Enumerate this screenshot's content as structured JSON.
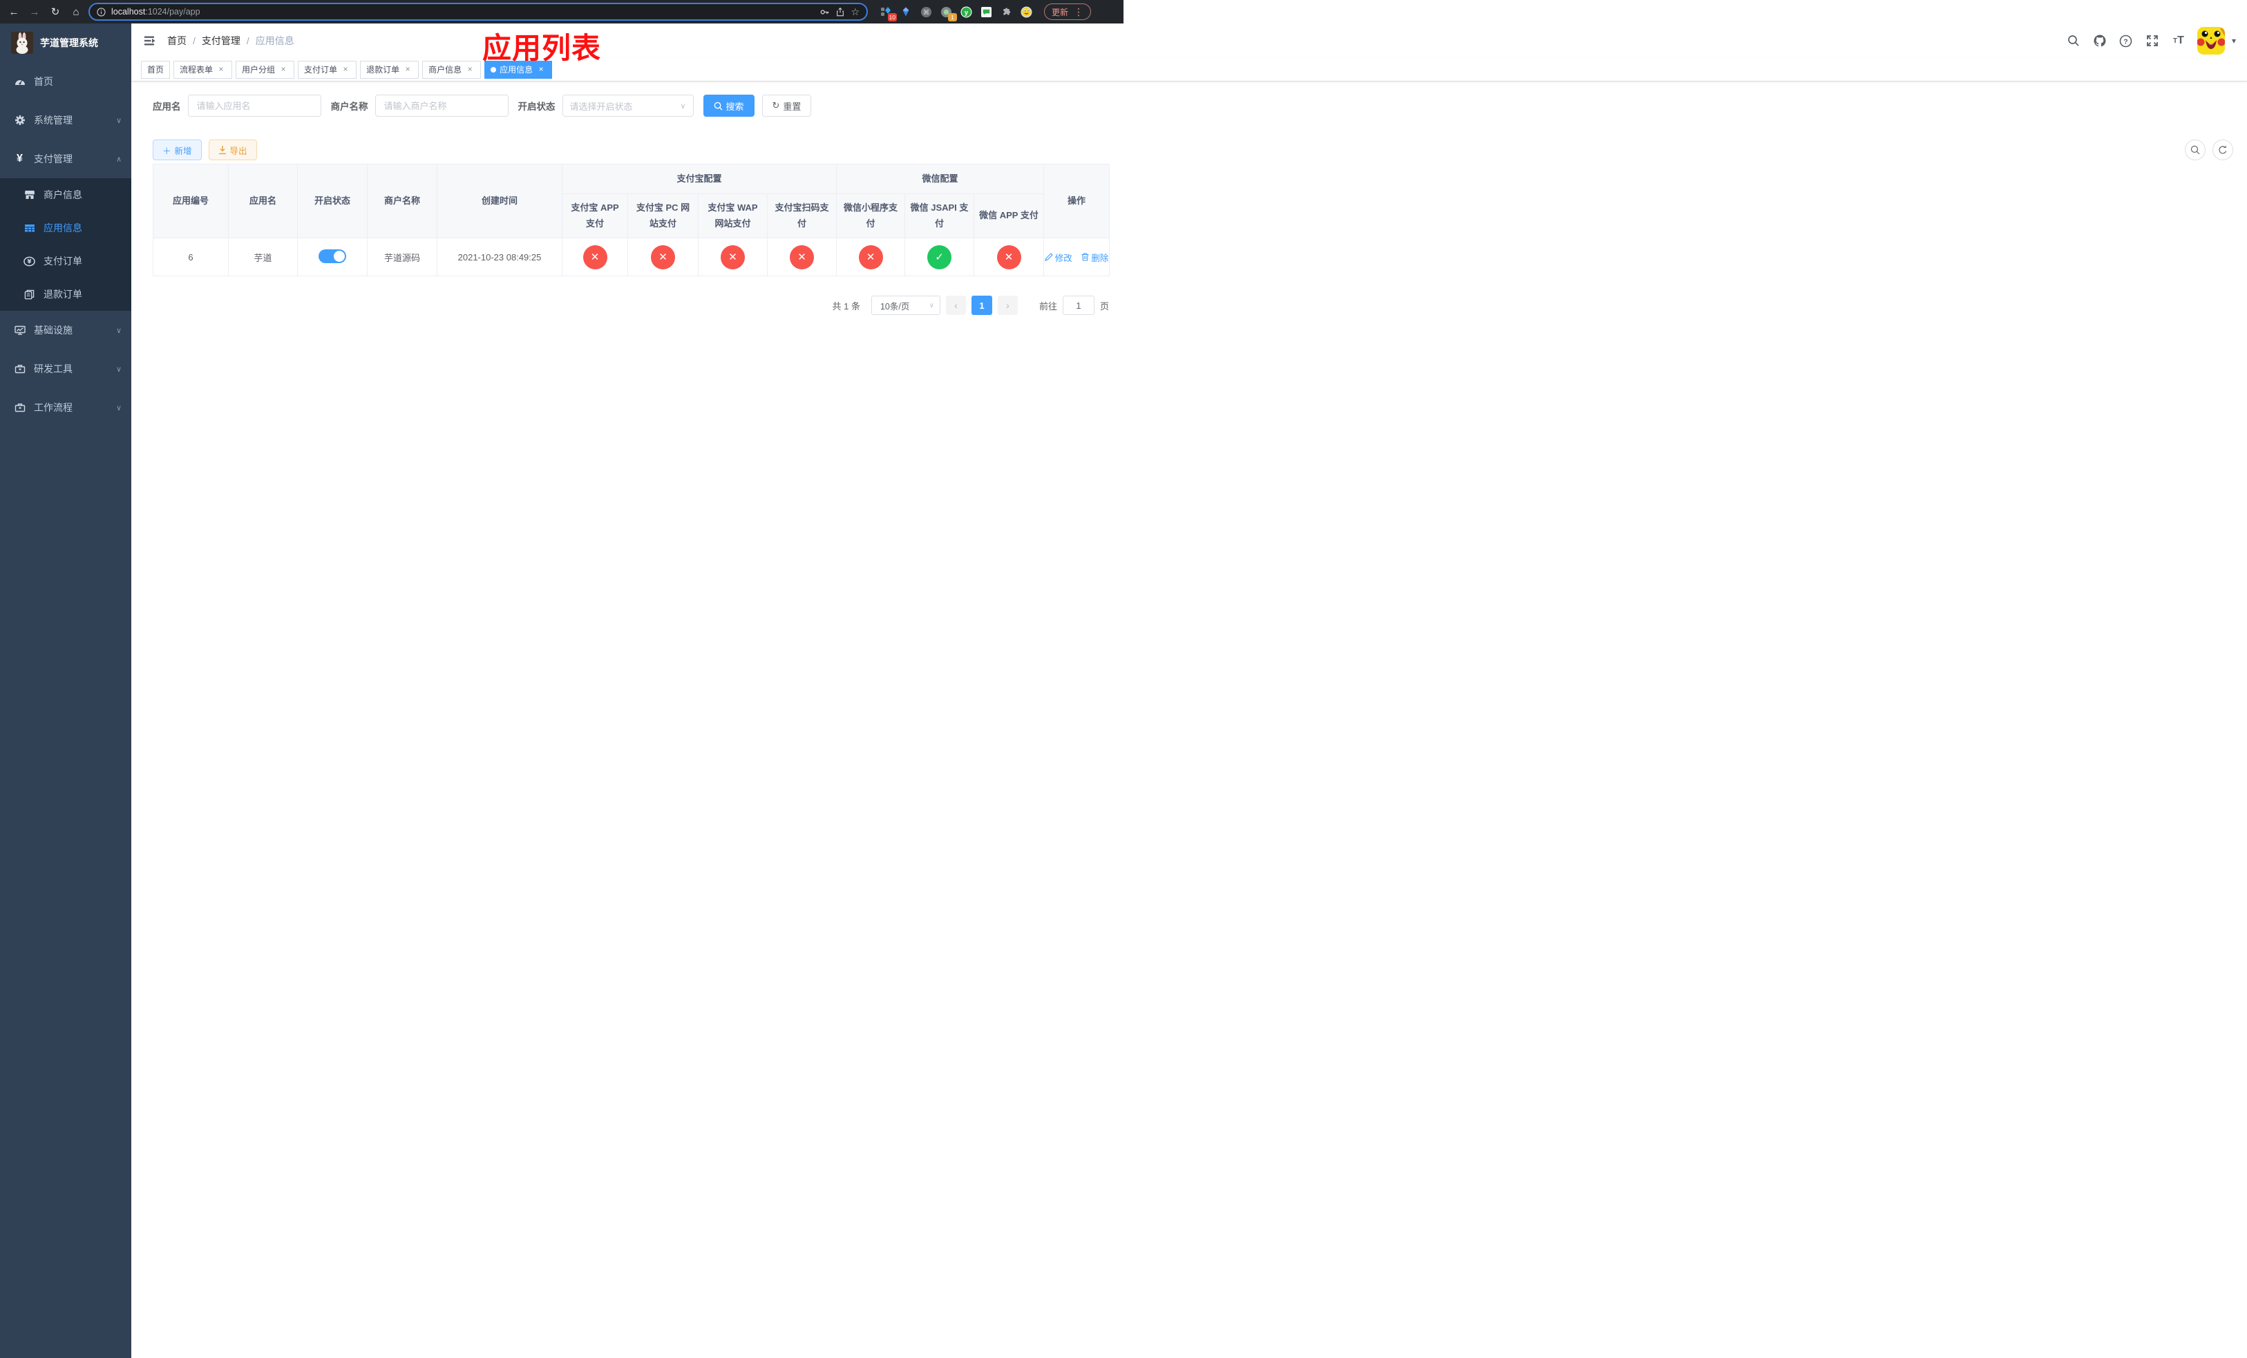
{
  "browser": {
    "url_host": "localhost",
    "url_rest": ":1024/pay/app",
    "ext_badge_blocks": "10",
    "ext_badge_rec": "1",
    "update_label": "更新"
  },
  "sidebar": {
    "title": "芋道管理系统",
    "items": [
      {
        "label": "首页"
      },
      {
        "label": "系统管理"
      },
      {
        "label": "支付管理"
      },
      {
        "label": "商户信息"
      },
      {
        "label": "应用信息"
      },
      {
        "label": "支付订单"
      },
      {
        "label": "退款订单"
      },
      {
        "label": "基础设施"
      },
      {
        "label": "研发工具"
      },
      {
        "label": "工作流程"
      }
    ]
  },
  "navbar": {
    "breadcrumb": [
      {
        "label": "首页"
      },
      {
        "label": "支付管理"
      },
      {
        "label": "应用信息"
      }
    ]
  },
  "annotation": {
    "text": "应用列表"
  },
  "tabs": [
    {
      "label": "首页"
    },
    {
      "label": "流程表单"
    },
    {
      "label": "用户分组"
    },
    {
      "label": "支付订单"
    },
    {
      "label": "退款订单"
    },
    {
      "label": "商户信息"
    },
    {
      "label": "应用信息"
    }
  ],
  "filters": {
    "app_name_label": "应用名",
    "app_name_placeholder": "请输入应用名",
    "merchant_label": "商户名称",
    "merchant_placeholder": "请输入商户名称",
    "status_label": "开启状态",
    "status_placeholder": "请选择开启状态",
    "search_label": "搜索",
    "reset_label": "重置"
  },
  "toolbar": {
    "add_label": "新增",
    "export_label": "导出"
  },
  "table": {
    "groups": {
      "alipay": "支付宝配置",
      "wechat": "微信配置"
    },
    "columns": {
      "app_id": "应用编号",
      "app_name": "应用名",
      "status": "开启状态",
      "merchant": "商户名称",
      "create_time": "创建时间",
      "alipay_app": "支付宝 APP 支付",
      "alipay_pc": "支付宝 PC 网站支付",
      "alipay_wap": "支付宝 WAP 网站支付",
      "alipay_qr": "支付宝扫码支付",
      "wx_mini": "微信小程序支付",
      "wx_jsapi": "微信 JSAPI 支付",
      "wx_app": "微信 APP 支付",
      "actions": "操作"
    },
    "row": {
      "app_id": "6",
      "app_name": "芋道",
      "enabled": true,
      "merchant": "芋道源码",
      "create_time": "2021-10-23 08:49:25",
      "channels": [
        false,
        false,
        false,
        false,
        false,
        true,
        false
      ],
      "edit_label": "修改",
      "delete_label": "删除"
    }
  },
  "pagination": {
    "total": "共 1 条",
    "page_size": "10条/页",
    "current_page": "1",
    "goto_label": "前往",
    "goto_value": "1",
    "goto_suffix": "页"
  },
  "colors": {
    "accent": "#409eff",
    "success": "#1fc75f",
    "danger": "#f8544b",
    "warning": "#e6a23c"
  }
}
